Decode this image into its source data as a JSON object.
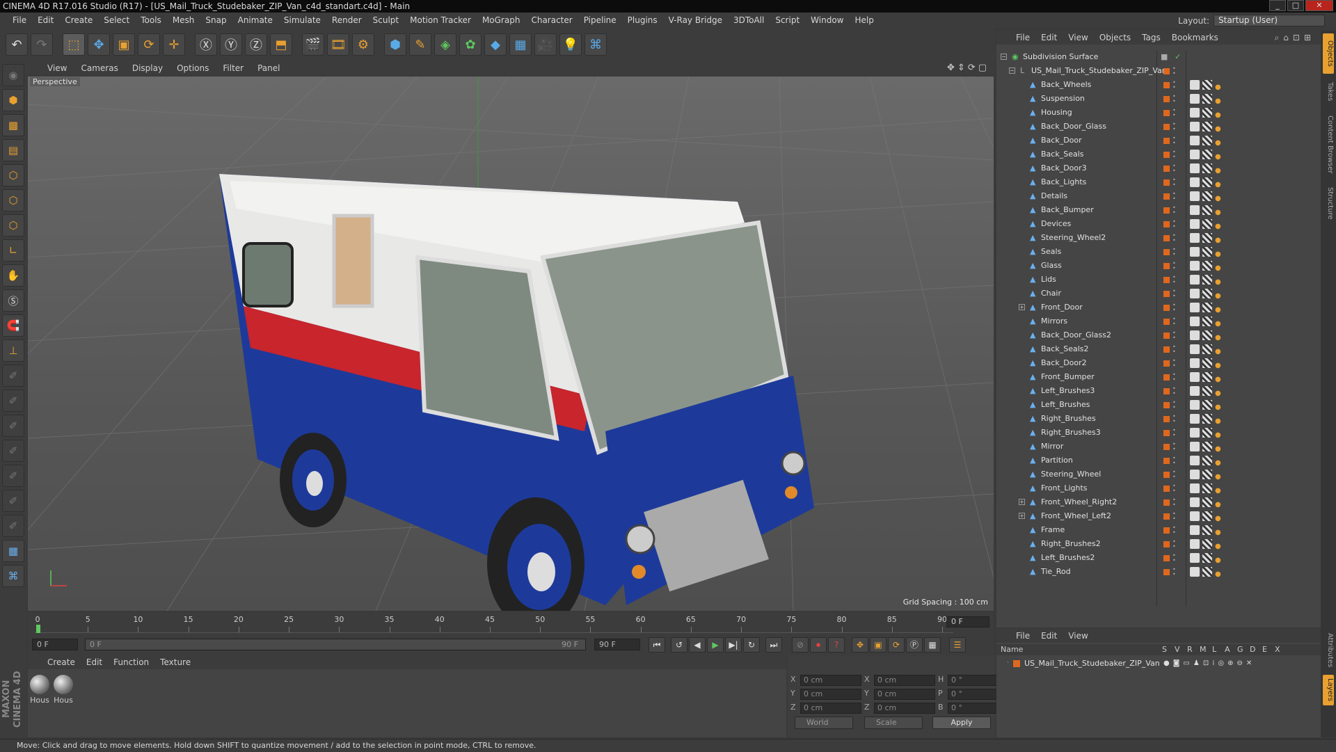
{
  "window": {
    "title": "CINEMA 4D R17.016 Studio (R17) - [US_Mail_Truck_Studebaker_ZIP_Van_c4d_standart.c4d] - Main"
  },
  "menu": [
    "File",
    "Edit",
    "Create",
    "Select",
    "Tools",
    "Mesh",
    "Snap",
    "Animate",
    "Simulate",
    "Render",
    "Sculpt",
    "Motion Tracker",
    "MoGraph",
    "Character",
    "Pipeline",
    "Plugins",
    "V-Ray Bridge",
    "3DToAll",
    "Script",
    "Window",
    "Help"
  ],
  "layout": {
    "label": "Layout:",
    "value": "Startup (User)"
  },
  "viewport": {
    "menu": [
      "View",
      "Cameras",
      "Display",
      "Options",
      "Filter",
      "Panel"
    ],
    "label": "Perspective",
    "grid_spacing": "Grid Spacing : 100 cm"
  },
  "timeline": {
    "ticks": [
      "0",
      "5",
      "10",
      "15",
      "20",
      "25",
      "30",
      "35",
      "40",
      "45",
      "50",
      "55",
      "60",
      "65",
      "70",
      "75",
      "80",
      "85",
      "90"
    ],
    "current": "0 F"
  },
  "playback": {
    "start": "0 F",
    "range_start": "0 F",
    "range_end": "90 F",
    "end": "90 F"
  },
  "materials": {
    "menu": [
      "Create",
      "Edit",
      "Function",
      "Texture"
    ],
    "items": [
      "Hous",
      "Hous"
    ]
  },
  "coords": {
    "rows": [
      {
        "a": "X",
        "av": "0 cm",
        "b": "X",
        "bv": "0 cm",
        "c": "H",
        "cv": "0 °"
      },
      {
        "a": "Y",
        "av": "0 cm",
        "b": "Y",
        "bv": "0 cm",
        "c": "P",
        "cv": "0 °"
      },
      {
        "a": "Z",
        "av": "0 cm",
        "b": "Z",
        "bv": "0 cm",
        "c": "B",
        "cv": "0 °"
      }
    ],
    "world": "World",
    "scale": "Scale",
    "apply": "Apply"
  },
  "objects": {
    "menu": [
      "File",
      "Edit",
      "View",
      "Objects",
      "Tags",
      "Bookmarks"
    ],
    "root": "Subdivision Surface",
    "group": "US_Mail_Truck_Studebaker_ZIP_Van",
    "children": [
      "Back_Wheels",
      "Suspension",
      "Housing",
      "Back_Door_Glass",
      "Back_Door",
      "Back_Seals",
      "Back_Door3",
      "Back_Lights",
      "Details",
      "Back_Bumper",
      "Devices",
      "Steering_Wheel2",
      "Seals",
      "Glass",
      "Lids",
      "Chair",
      "Front_Door",
      "Mirrors",
      "Back_Door_Glass2",
      "Back_Seals2",
      "Back_Door2",
      "Front_Bumper",
      "Left_Brushes3",
      "Left_Brushes",
      "Right_Brushes",
      "Right_Brushes3",
      "Mirror",
      "Partition",
      "Steering_Wheel",
      "Front_Lights",
      "Front_Wheel_Right2",
      "Front_Wheel_Left2",
      "Frame",
      "Right_Brushes2",
      "Left_Brushes2",
      "Tie_Rod"
    ]
  },
  "layers": {
    "menu": [
      "File",
      "Edit",
      "View"
    ],
    "headers": [
      "Name",
      "S",
      "V",
      "R",
      "M",
      "L",
      "A",
      "G",
      "D",
      "E",
      "X"
    ],
    "item": "US_Mail_Truck_Studebaker_ZIP_Van"
  },
  "right_tabs": [
    "Objects",
    "Takes",
    "Content Browser",
    "Structure",
    "Attributes",
    "Layers"
  ],
  "status": "Move: Click and drag to move elements. Hold down SHIFT to quantize movement / add to the selection in point mode, CTRL to remove.",
  "colors": {
    "accent": "#e8a030",
    "object_dot": "#e0671e",
    "close": "#b8251c"
  }
}
